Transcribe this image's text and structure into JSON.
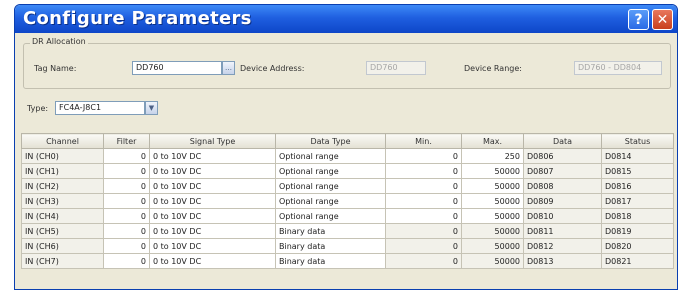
{
  "window": {
    "title": "Configure Parameters",
    "help_glyph": "?",
    "close_glyph": "✕"
  },
  "allocation": {
    "legend": "DR Allocation",
    "tag_name_label": "Tag Name:",
    "tag_name_value": "DD760",
    "device_address_label": "Device Address:",
    "device_address_value": "DD760",
    "device_range_label": "Device Range:",
    "device_range_value": "DD760 - DD804"
  },
  "type": {
    "label": "Type:",
    "value": "FC4A-J8C1"
  },
  "table": {
    "columns": [
      "Channel",
      "Filter",
      "Signal Type",
      "Data Type",
      "Min.",
      "Max.",
      "Data",
      "Status"
    ],
    "rows": [
      [
        "IN (CH0)",
        "0",
        "0 to 10V DC",
        "Optional range",
        "0",
        "250",
        "D0806",
        "D0814"
      ],
      [
        "IN (CH1)",
        "0",
        "0 to 10V DC",
        "Optional range",
        "0",
        "50000",
        "D0807",
        "D0815"
      ],
      [
        "IN (CH2)",
        "0",
        "0 to 10V DC",
        "Optional range",
        "0",
        "50000",
        "D0808",
        "D0816"
      ],
      [
        "IN (CH3)",
        "0",
        "0 to 10V DC",
        "Optional range",
        "0",
        "50000",
        "D0809",
        "D0817"
      ],
      [
        "IN (CH4)",
        "0",
        "0 to 10V DC",
        "Optional range",
        "0",
        "50000",
        "D0810",
        "D0818"
      ],
      [
        "IN (CH5)",
        "0",
        "0 to 10V DC",
        "Binary data",
        "0",
        "50000",
        "D0811",
        "D0819"
      ],
      [
        "IN (CH6)",
        "0",
        "0 to 10V DC",
        "Binary data",
        "0",
        "50000",
        "D0812",
        "D0820"
      ],
      [
        "IN (CH7)",
        "0",
        "0 to 10V DC",
        "Binary data",
        "0",
        "50000",
        "D0813",
        "D0821"
      ]
    ]
  }
}
